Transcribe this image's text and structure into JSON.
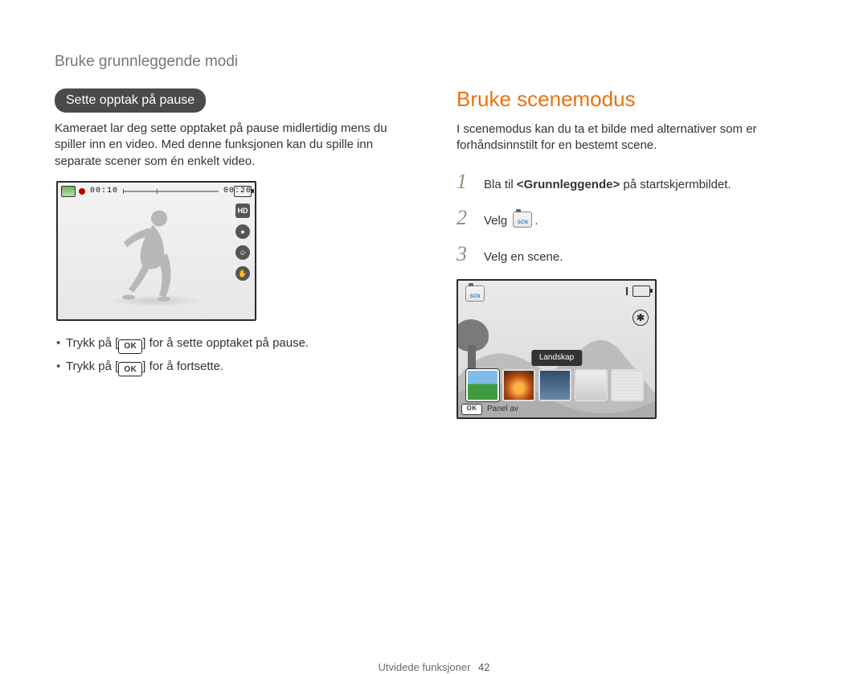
{
  "page": {
    "breadcrumb": "Bruke grunnleggende modi",
    "footer_label": "Utvidede funksjoner",
    "page_number": "42"
  },
  "left": {
    "pill": "Sette opptak på pause",
    "intro": "Kameraet lar deg sette opptaket på pause midlertidig mens du spiller inn en video. Med denne funksjonen kan du spille inn separate scener som én enkelt video.",
    "fig1": {
      "elapsed": "00:10",
      "total": "00:20",
      "right_icons": [
        "HD",
        "mic",
        "face",
        "eis"
      ],
      "icon_labels": {
        "HD": "HD",
        "mic": "●",
        "face": "☺",
        "eis": "✋"
      }
    },
    "bullets": {
      "prefix": "Trykk på [",
      "ok": "OK",
      "b1_suffix": "] for å sette opptaket på pause.",
      "b2_suffix": "] for å fortsette."
    }
  },
  "right": {
    "heading": "Bruke scenemodus",
    "intro": "I scenemodus kan du ta et bilde med alternativer som er forhåndsinnstilt for en bestemt scene.",
    "steps": {
      "1": {
        "pre": "Bla til ",
        "bold": "<Grunnleggende>",
        "post": " på startskjermbildet."
      },
      "2": {
        "pre": "Velg ",
        "post": "."
      },
      "3": {
        "pre": "Velg en scene."
      }
    },
    "fig2": {
      "scn_label": "SCN",
      "tooltip": "Landskap",
      "ok": "OK",
      "panel_off": "Panel av",
      "flash_glyph": "✱"
    }
  }
}
